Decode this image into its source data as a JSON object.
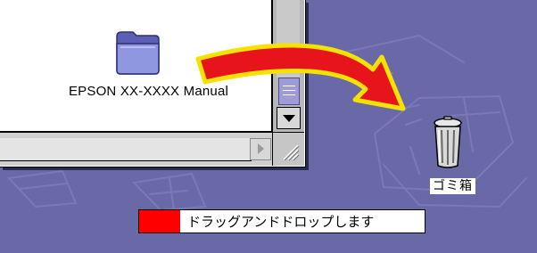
{
  "window": {
    "folder_name": "EPSON XX-XXXX Manual"
  },
  "desktop": {
    "trash_label": "ゴミ箱"
  },
  "caption": {
    "text": "ドラッグアンドドロップします"
  },
  "icons": {
    "folder": "folder-icon",
    "trash": "trash-can-icon",
    "drag_arrow": "curved-arrow",
    "scroll_down": "triangle-down-icon",
    "scroll_right": "triangle-right-icon",
    "resize": "grow-box-icon"
  },
  "colors": {
    "desktop_background": "#6a69a8",
    "arrow_fill": "#e8141c",
    "arrow_outline": "#f5e200",
    "caption_swatch": "#ff0000",
    "folder": "#8f97e0"
  }
}
